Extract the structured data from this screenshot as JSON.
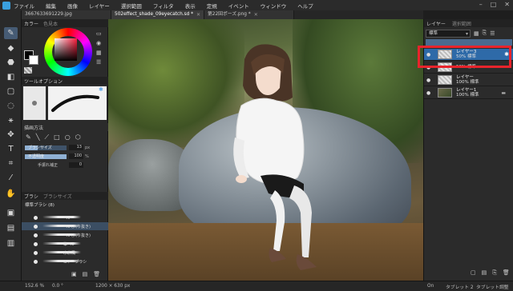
{
  "menubar": {
    "items": [
      "ファイル",
      "編集",
      "画像",
      "レイヤー",
      "選択範囲",
      "フィルタ",
      "表示",
      "定規",
      "イベント",
      "ウィンドウ",
      "ヘルプ"
    ]
  },
  "tabs": [
    {
      "label": "3667633691229.jpg"
    },
    {
      "label": "502effect_shade_09eyecatch.sd *"
    },
    {
      "label": "第22回ポーズ.png *"
    }
  ],
  "color_panel": {
    "tab_active": "カラー",
    "tab_other": "色見本"
  },
  "brush_control": {
    "title": "ツールオプション"
  },
  "brush_props": {
    "section_label": "描画方法",
    "size_label": "ブラシサイズ",
    "size_value": "13",
    "size_unit": "px",
    "size_fraction": 0.3,
    "opacity_label": "不透明度",
    "opacity_value": "100",
    "opacity_unit": "%",
    "opacity_fraction": 1.0,
    "correction_label": "手振れ補正",
    "correction_value": "0"
  },
  "brush_panel": {
    "tab_active": "ブラシ",
    "tab_other": "ブラシサイズ",
    "group": "標準ブラシ (8)",
    "items": [
      "ペン",
      "ペン(入り抜き)",
      "ペン(入り抜き)",
      "筆ペン",
      "水彩風",
      "エアーブラシ"
    ]
  },
  "layers": {
    "tab_active": "レイヤー",
    "tab_other": "選択範囲",
    "blend_mode": "標準",
    "items": [
      {
        "name": "レイヤー3",
        "mode": "50% 標準",
        "selected": true
      },
      {
        "name": "",
        "mode": "50% 標準",
        "selected": false
      },
      {
        "name": "レイヤー",
        "mode": "100% 標準",
        "selected": false
      },
      {
        "name": "レイヤー1",
        "mode": "100% 標準",
        "selected": false
      }
    ]
  },
  "status": {
    "zoom": "152.6 %",
    "rotation": "0.0 °",
    "size": "1200 × 630 px",
    "pressure": "On",
    "tablet": "タブレット 2",
    "tablet_mode": "タブレット調整"
  },
  "colors": {
    "accent": "#2e6aa8",
    "highlight": "#e8242c",
    "foreground": "#000000",
    "background": "#ffffff"
  }
}
